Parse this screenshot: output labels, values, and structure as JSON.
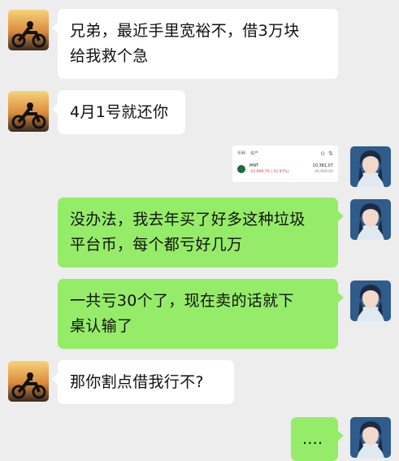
{
  "messages": [
    {
      "side": "left",
      "text": "兄弟，最近手里宽裕不，借3万块\n给我救个急"
    },
    {
      "side": "left",
      "text": "4月1号就还你"
    },
    {
      "side": "right",
      "type": "card"
    },
    {
      "side": "right",
      "text": "没办法，我去年买了好多这种垃圾\n平台币，每个都亏好几万"
    },
    {
      "side": "right",
      "text": "一共亏30个了，现在卖的话就下\n桌认输了"
    },
    {
      "side": "left",
      "text": "那你割点借我行不?"
    },
    {
      "side": "right",
      "text": "...."
    }
  ],
  "card": {
    "tab1": "币种",
    "tab2": "资产",
    "icon1": "⊙",
    "icon2": "⇅",
    "coin_name": "MNT",
    "loss": "-52,909.70 (-52.97%)",
    "value1": "10,381.07",
    "value2": "46,909.00"
  },
  "colors": {
    "background": "#ededed",
    "bubble_left": "#ffffff",
    "bubble_right": "#95ec69",
    "loss": "#d83a3a"
  }
}
